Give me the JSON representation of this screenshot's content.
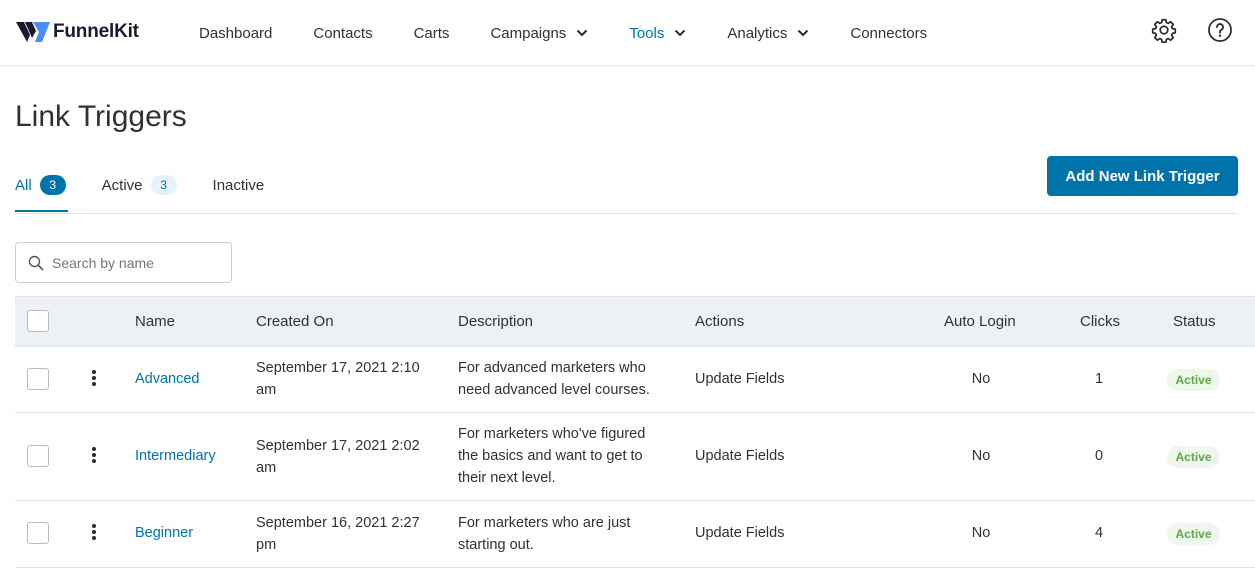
{
  "app": {
    "brand": "FunnelKit",
    "colors": {
      "accent": "#0073aa",
      "logo_light": "#4b8df8",
      "logo_dark": "#1a1a2e",
      "status_active_bg": "#eef7ec",
      "status_active_text": "#5ea84a",
      "table_header_bg": "#ebf1f5"
    }
  },
  "nav": {
    "items": [
      {
        "label": "Dashboard",
        "has_dropdown": false
      },
      {
        "label": "Contacts",
        "has_dropdown": false
      },
      {
        "label": "Carts",
        "has_dropdown": false
      },
      {
        "label": "Campaigns",
        "has_dropdown": true
      },
      {
        "label": "Tools",
        "has_dropdown": true,
        "active": true
      },
      {
        "label": "Analytics",
        "has_dropdown": true
      },
      {
        "label": "Connectors",
        "has_dropdown": false
      }
    ],
    "icons": [
      "gear-icon",
      "help-icon"
    ]
  },
  "page": {
    "title": "Link Triggers",
    "add_button": "Add New Link Trigger"
  },
  "tabs": [
    {
      "label": "All",
      "count": "3",
      "active": true
    },
    {
      "label": "Active",
      "count": "3"
    },
    {
      "label": "Inactive",
      "count": ""
    }
  ],
  "search": {
    "placeholder": "Search by name",
    "value": ""
  },
  "table": {
    "columns": [
      "Name",
      "Created On",
      "Description",
      "Actions",
      "Auto Login",
      "Clicks",
      "Status"
    ],
    "rows": [
      {
        "name": "Advanced",
        "created_line1": "September 17, 2021 2:10",
        "created_line2": "am",
        "desc_line1": "For advanced marketers who",
        "desc_line2": "need advanced level courses.",
        "desc_line3": "",
        "actions": "Update Fields",
        "auto_login": "No",
        "clicks": "1",
        "status": "Active"
      },
      {
        "name": "Intermediary",
        "created_line1": "September 17, 2021 2:02",
        "created_line2": "am",
        "desc_line1": "For marketers who've figured",
        "desc_line2": "the basics and want to get to",
        "desc_line3": "their next level.",
        "actions": "Update Fields",
        "auto_login": "No",
        "clicks": "0",
        "status": "Active"
      },
      {
        "name": "Beginner",
        "created_line1": "September 16, 2021 2:27",
        "created_line2": "pm",
        "desc_line1": "For marketers who are just",
        "desc_line2": "starting out.",
        "desc_line3": "",
        "actions": "Update Fields",
        "auto_login": "No",
        "clicks": "4",
        "status": "Active"
      }
    ]
  }
}
